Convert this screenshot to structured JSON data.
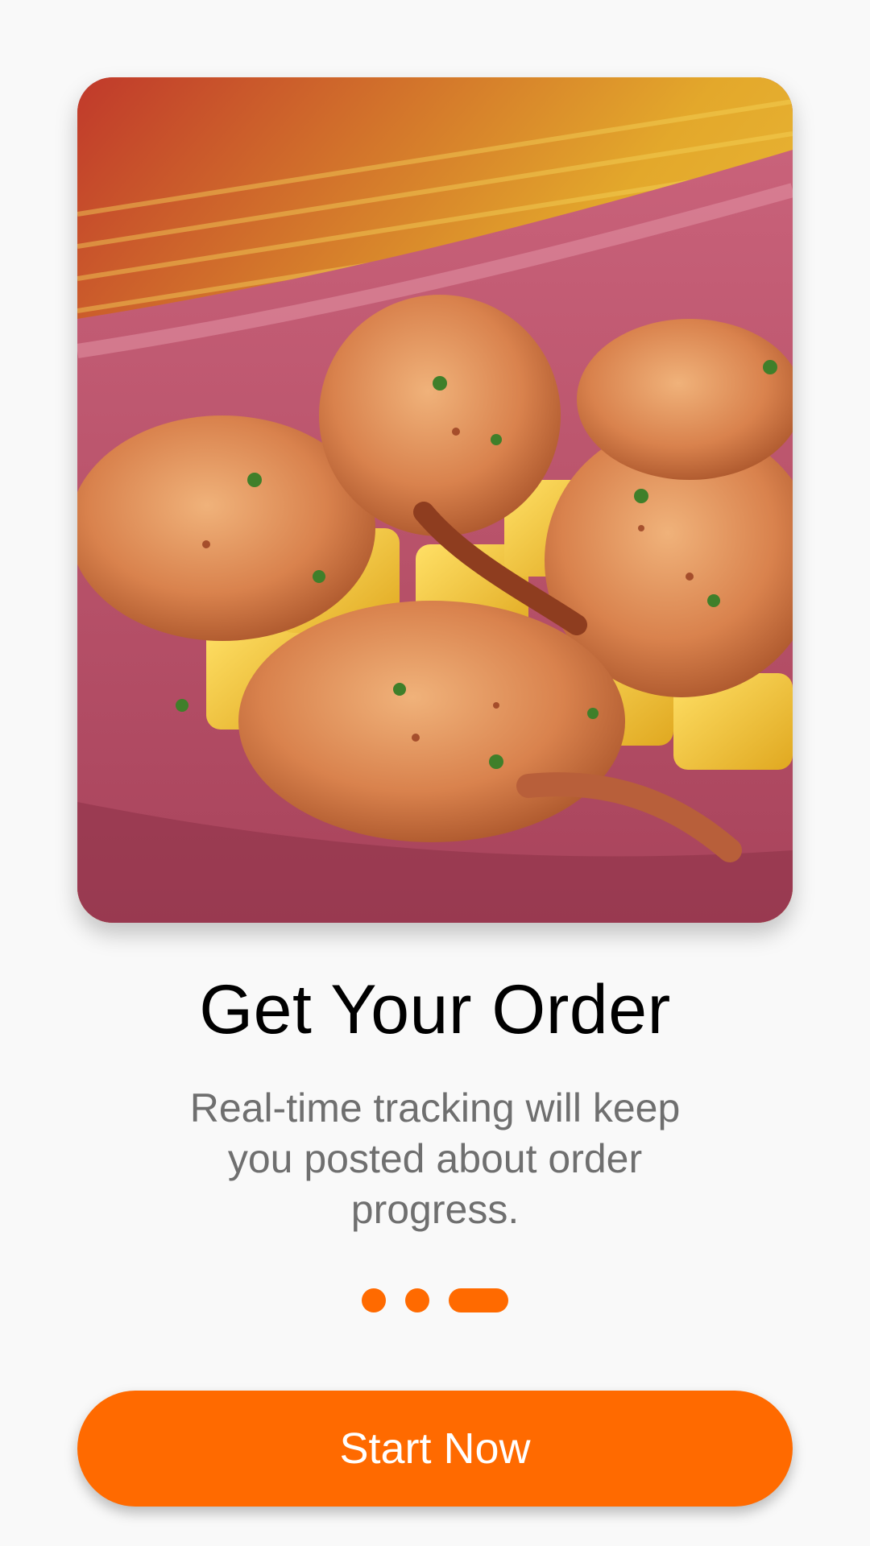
{
  "onboarding": {
    "hero_image": "food-photo-shrimp-mango-plate",
    "title": "Get Your Order",
    "description": "Real-time tracking will keep you posted about order progress.",
    "pager": {
      "total": 3,
      "current": 3
    },
    "start_button_label": "Start Now"
  },
  "colors": {
    "accent": "#ff6a00",
    "background": "#f9f9f9",
    "title": "#000000",
    "description": "#6f6f6f"
  }
}
